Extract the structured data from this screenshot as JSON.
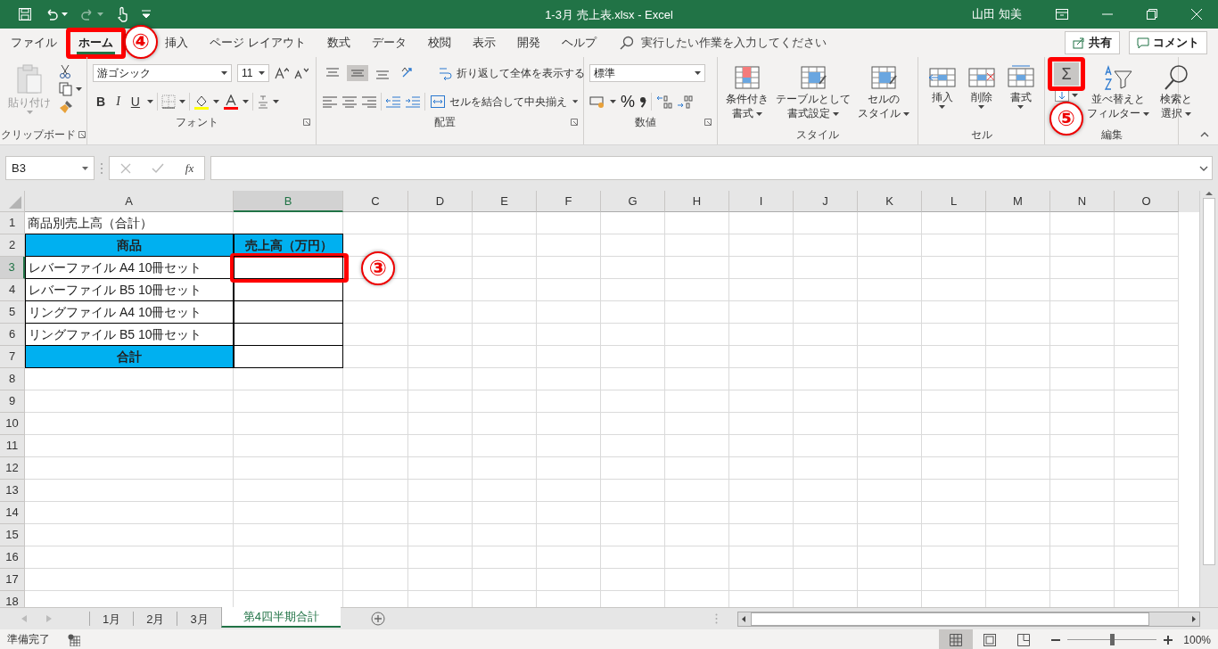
{
  "title_bar": {
    "title": "1-3月 売上表.xlsx  -  Excel",
    "user": "山田 知美"
  },
  "menu_tabs": [
    {
      "label": "ファイル",
      "selected": false
    },
    {
      "label": "ホーム",
      "selected": true,
      "callout": "④"
    },
    {
      "label": "挿入",
      "selected": false
    },
    {
      "label": "ページ レイアウト",
      "selected": false
    },
    {
      "label": "数式",
      "selected": false
    },
    {
      "label": "データ",
      "selected": false
    },
    {
      "label": "校閲",
      "selected": false
    },
    {
      "label": "表示",
      "selected": false
    },
    {
      "label": "開発",
      "selected": false
    },
    {
      "label": "ヘルプ",
      "selected": false
    }
  ],
  "tell_me": {
    "placeholder": "実行したい作業を入力してください"
  },
  "share": "共有",
  "comment": "コメント",
  "ribbon": {
    "clipboard": {
      "paste": {
        "label": "貼り付け",
        "disabled": true
      },
      "label": "クリップボード"
    },
    "font": {
      "font_name": "游ゴシック",
      "font_size": "11",
      "bold": "B",
      "italic": "I",
      "underline": "U",
      "label": "フォント"
    },
    "alignment": {
      "vertical": [
        {
          "selected": false
        },
        {
          "selected": true
        },
        {
          "selected": false
        }
      ],
      "wrap_text": "折り返して全体を表示する",
      "merge_center": "セルを結合して中央揃え",
      "label": "配置"
    },
    "number": {
      "format": "標準",
      "percent": "%",
      "label": "数値"
    },
    "styles": {
      "buttons": [
        {
          "lines": [
            "条件付き",
            "書式"
          ]
        },
        {
          "lines": [
            "テーブルとして",
            "書式設定"
          ]
        },
        {
          "lines": [
            "セルの",
            "スタイル"
          ]
        }
      ],
      "label": "スタイル"
    },
    "cells": {
      "buttons": [
        {
          "label": "挿入"
        },
        {
          "label": "削除"
        },
        {
          "label": "書式"
        }
      ],
      "label": "セル"
    },
    "editing": {
      "autosum": {
        "label": "Σ",
        "callout": "⑤"
      },
      "buttons": [
        {
          "lines": [
            "並べ替えと",
            "フィルター"
          ]
        },
        {
          "lines": [
            "検索と",
            "選択"
          ]
        }
      ],
      "label": "編集"
    }
  },
  "formula_bar": {
    "name_box": "B3",
    "function_label": "fx"
  },
  "sheet": {
    "columns": [
      {
        "label": "A",
        "selected": false
      },
      {
        "label": "B",
        "selected": true
      },
      {
        "label": "C",
        "selected": false
      },
      {
        "label": "D",
        "selected": false
      },
      {
        "label": "E",
        "selected": false
      },
      {
        "label": "F",
        "selected": false
      },
      {
        "label": "G",
        "selected": false
      },
      {
        "label": "H",
        "selected": false
      },
      {
        "label": "I",
        "selected": false
      },
      {
        "label": "J",
        "selected": false
      },
      {
        "label": "K",
        "selected": false
      },
      {
        "label": "L",
        "selected": false
      },
      {
        "label": "M",
        "selected": false
      },
      {
        "label": "N",
        "selected": false
      },
      {
        "label": "O",
        "selected": false
      }
    ],
    "rows": [
      {
        "label": "1",
        "selected": false
      },
      {
        "label": "2",
        "selected": false
      },
      {
        "label": "3",
        "selected": true
      },
      {
        "label": "4",
        "selected": false
      },
      {
        "label": "5",
        "selected": false
      },
      {
        "label": "6",
        "selected": false
      },
      {
        "label": "7",
        "selected": false
      },
      {
        "label": "8",
        "selected": false
      },
      {
        "label": "9",
        "selected": false
      },
      {
        "label": "10",
        "selected": false
      },
      {
        "label": "11",
        "selected": false
      },
      {
        "label": "12",
        "selected": false
      },
      {
        "label": "13",
        "selected": false
      },
      {
        "label": "14",
        "selected": false
      },
      {
        "label": "15",
        "selected": false
      },
      {
        "label": "16",
        "selected": false
      },
      {
        "label": "17",
        "selected": false
      },
      {
        "label": "18",
        "selected": false
      }
    ],
    "cells": [
      [
        {
          "kind": "plain",
          "text": "商品別売上高（合計）"
        },
        {
          "kind": "plain"
        }
      ],
      [
        {
          "kind": "header",
          "text": "商品"
        },
        {
          "kind": "header",
          "text": "売上高（万円）"
        }
      ],
      [
        {
          "kind": "item",
          "text": "レバーファイル A4 10冊セット"
        },
        {
          "kind": "item",
          "callout": "③"
        }
      ],
      [
        {
          "kind": "item",
          "text": "レバーファイル B5 10冊セット"
        },
        {
          "kind": "item"
        }
      ],
      [
        {
          "kind": "item",
          "text": "リングファイル A4 10冊セット"
        },
        {
          "kind": "item"
        }
      ],
      [
        {
          "kind": "item",
          "text": "リングファイル B5 10冊セット"
        },
        {
          "kind": "item"
        }
      ],
      [
        {
          "kind": "header",
          "text": "合計"
        },
        {
          "kind": "item"
        }
      ]
    ]
  },
  "sheet_tabs": [
    {
      "label": "1月",
      "selected": false
    },
    {
      "label": "2月",
      "selected": false
    },
    {
      "label": "3月",
      "selected": false
    },
    {
      "label": "第4四半期合計",
      "selected": true
    }
  ],
  "status_bar": {
    "status": "準備完了",
    "views": [
      {
        "selected": true
      },
      {
        "selected": false
      },
      {
        "selected": false
      }
    ],
    "zoom": {
      "level": 0.5,
      "reading": "100%"
    }
  }
}
